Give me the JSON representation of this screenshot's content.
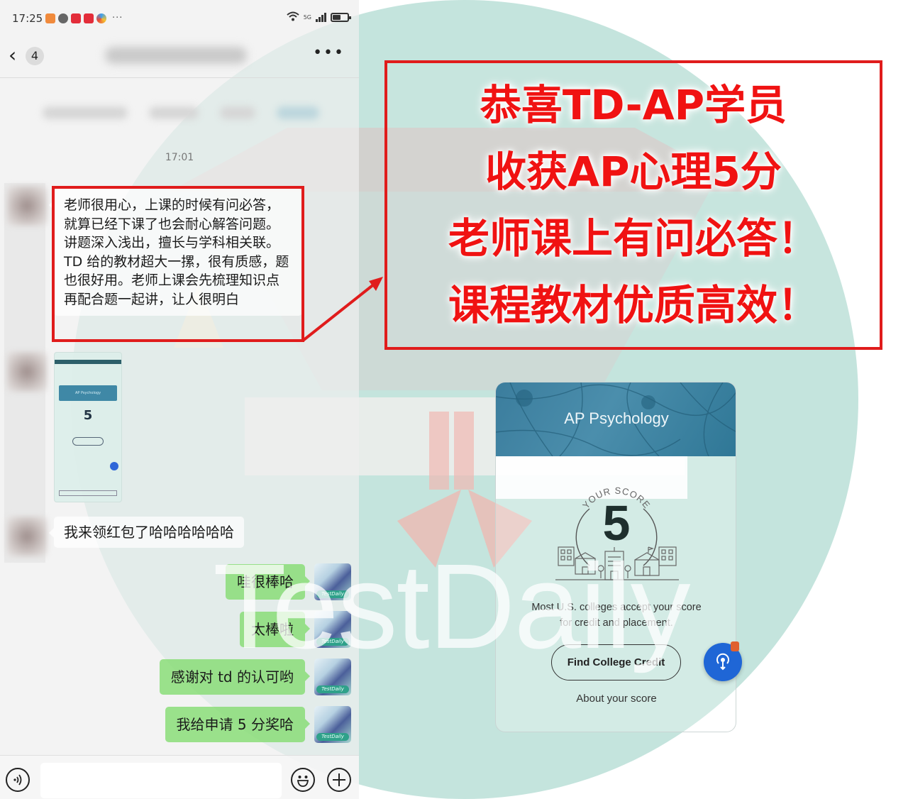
{
  "statusbar": {
    "time": "17:25",
    "network": "5G"
  },
  "chat": {
    "back_count": "4",
    "more_label": "•••",
    "time_separator": "17:01",
    "messages": [
      {
        "side": "in",
        "type": "text",
        "text": "老师很用心，上课的时候有问必答，就算已经下课了也会耐心解答问题。讲题深入浅出，擅长与学科相关联。TD 给的教材超大一摞，很有质感，题也很好用。老师上课会先梳理知识点再配合题一起讲，让人很明白"
      },
      {
        "side": "in",
        "type": "image",
        "thumb_score": "5"
      },
      {
        "side": "in",
        "type": "text",
        "text": "我来领红包了哈哈哈哈哈哈"
      },
      {
        "side": "out",
        "type": "text",
        "text": "哇很棒哈"
      },
      {
        "side": "out",
        "type": "text",
        "text": "太棒啦"
      },
      {
        "side": "out",
        "type": "text",
        "text": "感谢对 td 的认可哟"
      },
      {
        "side": "out",
        "type": "text",
        "text": "我给申请 5 分奖哈"
      }
    ],
    "avatar_tag": "TestDaily",
    "input_placeholder": ""
  },
  "callout": {
    "lines": [
      "恭喜TD-AP学员",
      "收获AP心理5分",
      "老师课上有问必答！",
      "课程教材优质高效！"
    ],
    "color": "#f01212"
  },
  "score_card": {
    "title": "AP Psychology",
    "score_label": "YOUR SCORE",
    "score": "5",
    "description": "Most U.S. colleges accept your score for credit and placement.",
    "button_label": "Find College Credit",
    "link_label": "About your score"
  },
  "watermark": "TestDaily",
  "colors": {
    "highlight_red": "#e01c1c",
    "bubble_green": "#8add78",
    "bg_teal": "#c4e4dd",
    "card_header": "#3b7d9d",
    "fab_blue": "#1f66d6"
  }
}
